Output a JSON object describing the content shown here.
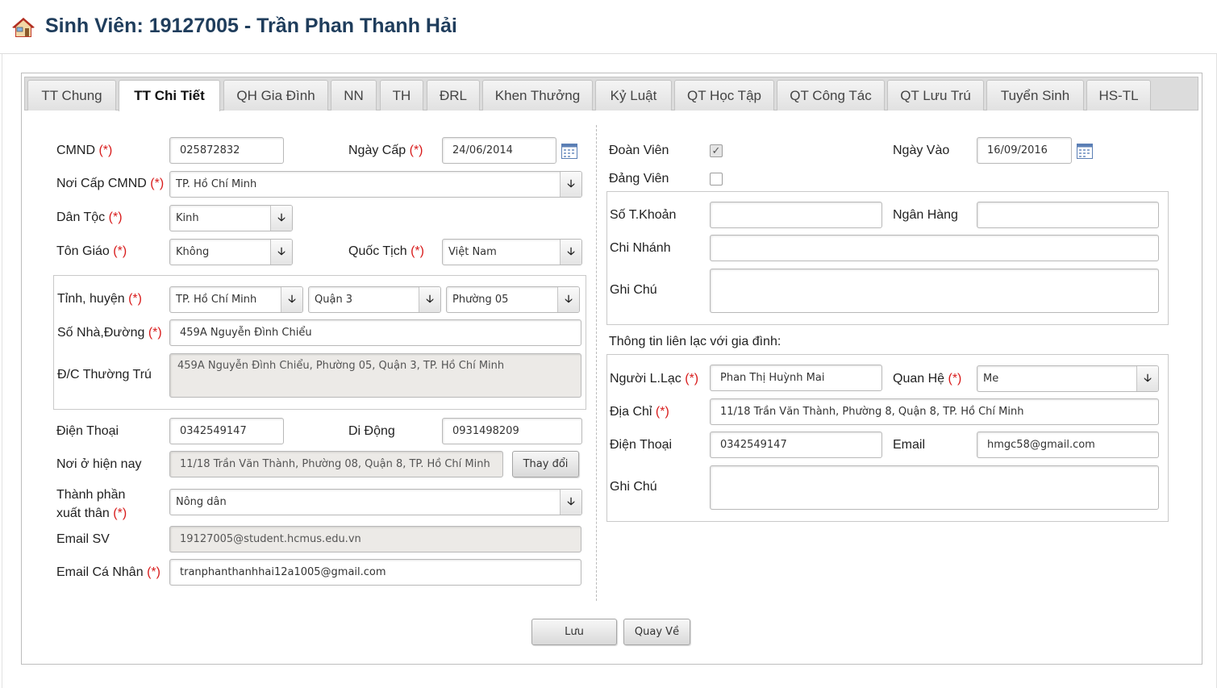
{
  "header": {
    "title": "Sinh Viên: 19127005 - Trần Phan Thanh Hải"
  },
  "tabs": [
    "TT Chung",
    "TT Chi Tiết",
    "QH Gia Đình",
    "NN",
    "TH",
    "ĐRL",
    "Khen Thưởng",
    "Kỷ Luật",
    "QT Học Tập",
    "QT Công Tác",
    "QT Lưu Trú",
    "Tuyển Sinh",
    "HS-TL"
  ],
  "active_tab": "TT Chi Tiết",
  "required_mark": "(*)",
  "left": {
    "cmnd": {
      "label": "CMND",
      "value": "025872832"
    },
    "ngay_cap": {
      "label": "Ngày Cấp",
      "value": "24/06/2014"
    },
    "noi_cap": {
      "label": "Nơi Cấp CMND",
      "value": "TP. Hồ Chí Minh"
    },
    "dan_toc": {
      "label": "Dân Tộc",
      "value": "Kinh"
    },
    "ton_giao": {
      "label": "Tôn Giáo",
      "value": "Không"
    },
    "quoc_tich": {
      "label": "Quốc Tịch",
      "value": "Việt Nam"
    },
    "tinh_huyen": {
      "label": "Tỉnh, huyện",
      "tinh": "TP. Hồ Chí Minh",
      "huyen": "Quận 3",
      "phuong": "Phường 05"
    },
    "so_nha": {
      "label": "Số Nhà,Đường",
      "value": "459A Nguyễn Đình Chiểu"
    },
    "dc_thuong_tru": {
      "label": "Đ/C Thường Trú",
      "value": "459A Nguyễn Đình Chiểu, Phường 05, Quận 3, TP. Hồ Chí Minh"
    },
    "dien_thoai": {
      "label": "Điện Thoại",
      "value": "0342549147"
    },
    "di_dong": {
      "label": "Di Động",
      "value": "0931498209"
    },
    "noi_o": {
      "label": "Nơi ở hiện nay",
      "value": "11/18 Trần Văn Thành, Phường 08, Quận 8, TP. Hồ Chí Minh",
      "button": "Thay đổi"
    },
    "thanh_phan": {
      "label_line1": "Thành phần",
      "label_line2": "xuất thân",
      "value": "Nông dân"
    },
    "email_sv": {
      "label": "Email SV",
      "value": "19127005@student.hcmus.edu.vn"
    },
    "email_cn": {
      "label": "Email Cá Nhân",
      "value": "tranphanthanhhai12a1005@gmail.com"
    }
  },
  "right": {
    "doan_vien": {
      "label": "Đoàn Viên",
      "checked": true
    },
    "ngay_vao": {
      "label": "Ngày Vào",
      "value": "16/09/2016"
    },
    "dang_vien": {
      "label": "Đảng Viên",
      "checked": false
    },
    "so_tk": {
      "label": "Số T.Khoản",
      "value": ""
    },
    "ngan_hang": {
      "label": "Ngân Hàng",
      "value": ""
    },
    "chi_nhanh": {
      "label": "Chi Nhánh",
      "value": ""
    },
    "ghi_chu": {
      "label": "Ghi Chú",
      "value": ""
    },
    "family_heading": "Thông tin liên lạc với gia đình:",
    "nguoi_ll": {
      "label": "Người L.Lạc",
      "value": "Phan Thị Huỳnh Mai"
    },
    "quan_he": {
      "label": "Quan Hệ",
      "value": "Me"
    },
    "dia_chi": {
      "label": "Địa Chỉ",
      "value": "11/18 Trần Văn Thành, Phường 8, Quận 8, TP. Hồ Chí Minh"
    },
    "dien_thoai": {
      "label": "Điện Thoại",
      "value": "0342549147"
    },
    "email": {
      "label": "Email",
      "value": "hmgc58@gmail.com"
    },
    "ghi_chu2": {
      "label": "Ghi Chú",
      "value": ""
    }
  },
  "actions": {
    "save": "Lưu",
    "back": "Quay Về"
  },
  "icons": {
    "home": "home-icon",
    "calendar": "calendar-icon",
    "dropdown": "arrow-down-icon",
    "checkmark": "✓"
  },
  "colors": {
    "title": "#1f3d5c",
    "required": "#d81b1b",
    "readonly_bg": "#eceae7"
  }
}
